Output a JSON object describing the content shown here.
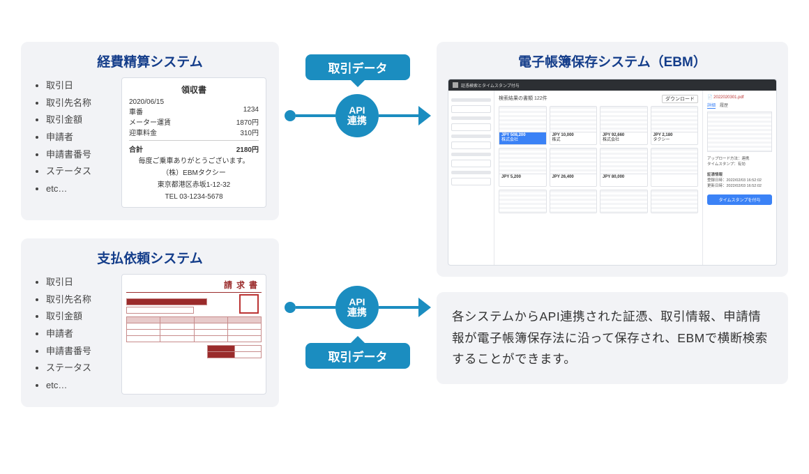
{
  "left": {
    "expense_system": {
      "title": "経費精算システム",
      "items": [
        "取引日",
        "取引先名称",
        "取引金額",
        "申請者",
        "申請書番号",
        "ステータス",
        "etc…"
      ],
      "receipt": {
        "title": "領収書",
        "date": "2020/06/15",
        "vehicle_label": "車番",
        "vehicle": "1234",
        "fare_label": "メーター運賃",
        "fare": "1870円",
        "toll_label": "迎車料金",
        "toll": "310円",
        "total_label": "合計",
        "total": "2180円",
        "thanks": "毎度ご乗車ありがとうございます。",
        "company": "（株）EBMタクシー",
        "address": "東京都港区赤坂1-12-32",
        "tel": "TEL 03-1234-5678"
      }
    },
    "payment_system": {
      "title": "支払依頼システム",
      "items": [
        "取引日",
        "取引先名称",
        "取引金額",
        "申請者",
        "申請書番号",
        "ステータス",
        "etc…"
      ],
      "invoice_title": "請求書"
    }
  },
  "connector": {
    "data_label": "取引データ",
    "api_line1": "API",
    "api_line2": "連携"
  },
  "right": {
    "title": "電子帳簿保存システム（EBM）",
    "app": {
      "topbar": "証憑検索とタイムスタンプ付与",
      "count": "検索結果の書類 122件",
      "download": "ダウンロード",
      "cards": [
        {
          "price": "JPY 508,200",
          "sub": "株式会社",
          "sel": true
        },
        {
          "price": "JPY 10,000",
          "sub": "株式"
        },
        {
          "price": "JPY 92,660",
          "sub": "株式会社"
        },
        {
          "price": "JPY 2,180",
          "sub": "タクシー"
        },
        {
          "price": "JPY 5,200",
          "sub": ""
        },
        {
          "price": "JPY 26,400",
          "sub": ""
        },
        {
          "price": "JPY 80,000",
          "sub": ""
        },
        {
          "price": "",
          "sub": ""
        }
      ],
      "detail": {
        "file": "2022020301.pdf",
        "tab1": "詳細",
        "tab2": "履歴",
        "meta1": "アップロード方法：連携",
        "meta2": "タイムスタンプ：有効",
        "meta3_label": "証憑情報",
        "meta3a": "登録日時：2022/02/03 16:52:02",
        "meta3b": "更新日時：2022/02/03 16:52:02",
        "button": "タイムスタンプを付与"
      }
    },
    "description": "各システムからAPI連携された証憑、取引情報、申請情報が電子帳簿保存法に沿って保存され、EBMで横断検索することができます。"
  }
}
